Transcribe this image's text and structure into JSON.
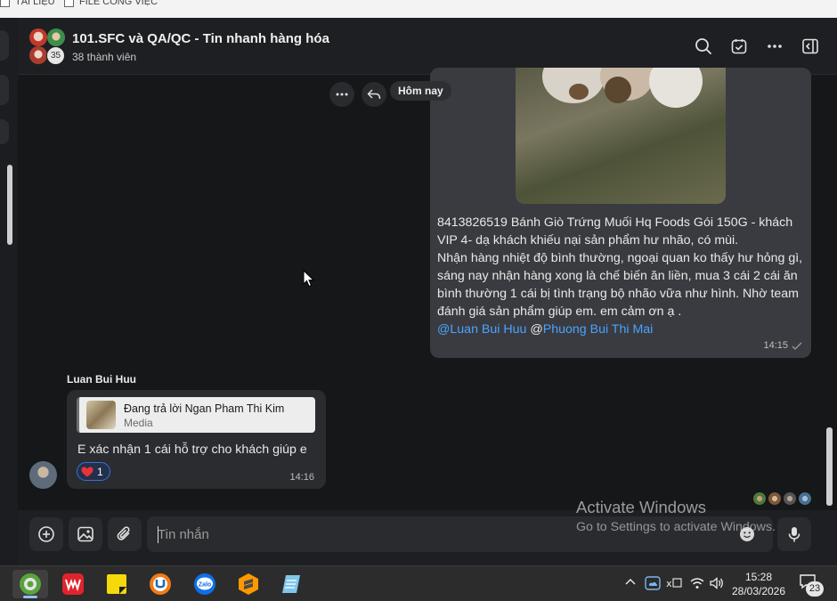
{
  "desktop": {
    "checkbox1": "TÀI LIỆU",
    "checkbox2": "FILE CÔNG VIỆC"
  },
  "header": {
    "title": "101.SFC và QA/QC - Tin nhanh hàng hóa",
    "member_count": "38 thành viên",
    "avatar_badge": "35"
  },
  "date_separator": "Hôm nay",
  "outgoing": {
    "lines": [
      "8413826519 Bánh Giò Trứng Muối Hq Foods Gói 150G - khách VIP 4- dạ khách khiếu nại sản phẩm hư nhão, có mùi.",
      "Nhận hàng nhiệt độ bình thường, ngoại quan ko thấy hư hỏng gì, sáng nay nhận hàng xong là chế biến ăn liền, mua 3 cái 2 cái ăn bình thường 1 cái bị tình trạng bộ nhão vữa như hình. Nhờ team đánh giá sản phẩm giúp em. em cảm ơn ạ ."
    ],
    "mention1": "@Luan Bui Huu",
    "mention_at": " @",
    "mention2": "Phuong Bui Thi Mai",
    "time": "14:15"
  },
  "incoming": {
    "sender": "Luan Bui Huu",
    "reply_title": "Đang trả lời Ngan Pham Thi Kim",
    "reply_sub": "Media",
    "text": "E xác nhận 1 cái hỗ trợ cho khách giúp e",
    "reaction_count": "1",
    "time": "14:16"
  },
  "input": {
    "placeholder": "Tin nhắn"
  },
  "watermark": {
    "line1": "Activate Windows",
    "line2": "Go to Settings to activate Windows."
  },
  "taskbar": {
    "time": "15:28",
    "date": "28/03/2026",
    "notification_count": "23",
    "apps": [
      "coccoc-browser",
      "wps-office",
      "sticky-notes",
      "ultraviewer",
      "zalo",
      "sublime-text",
      "notepad"
    ]
  },
  "colors": {
    "accent_mention": "#4aa3ff",
    "bubble_out": "#3a3b40",
    "bubble_in": "#2b2c30",
    "background": "#161719"
  }
}
